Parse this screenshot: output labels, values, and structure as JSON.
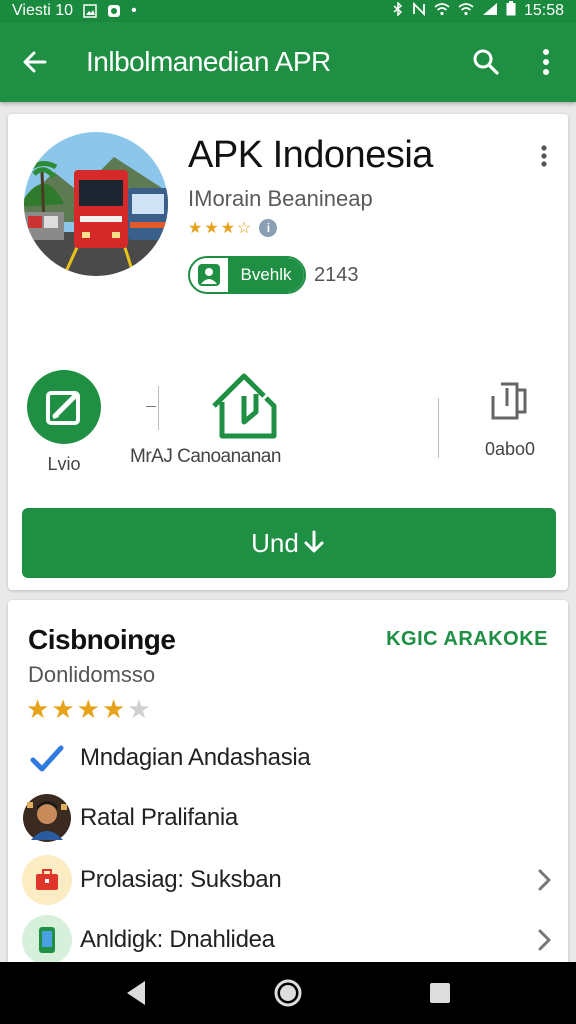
{
  "status_bar": {
    "left_text": "Viesti 10",
    "time": "15:58"
  },
  "toolbar": {
    "title": "Inlbolmanedian APR"
  },
  "app": {
    "name": "APK Indonesia",
    "developer": "IMorain Beanineap",
    "rating_stars": 3.5,
    "badge_label": "Bvehlk",
    "badge_count": "2143"
  },
  "actions": {
    "item1_label": "Lvio",
    "item2_label": "MrAJ Canoananan",
    "item3_label": "0abo0"
  },
  "install_button": {
    "label": "Und"
  },
  "list_section": {
    "title": "Cisbnoinge",
    "more_label": "KGIC ARAKOKE",
    "subtitle": "Donlidomsso",
    "rating_stars": 3.5,
    "rows": [
      {
        "label": "Mndagian Andashasia",
        "icon": "check-icon",
        "has_chevron": false
      },
      {
        "label": "Ratal Pralifania",
        "icon": "avatar-photo",
        "has_chevron": false
      },
      {
        "label": "Prolasiag: Suksban",
        "icon": "briefcase-icon",
        "has_chevron": true
      },
      {
        "label": "Anldigk: Dnahlidea",
        "icon": "phone-icon",
        "has_chevron": true
      }
    ]
  },
  "colors": {
    "brand_green": "#1f8f43",
    "star": "#e5a21a"
  }
}
